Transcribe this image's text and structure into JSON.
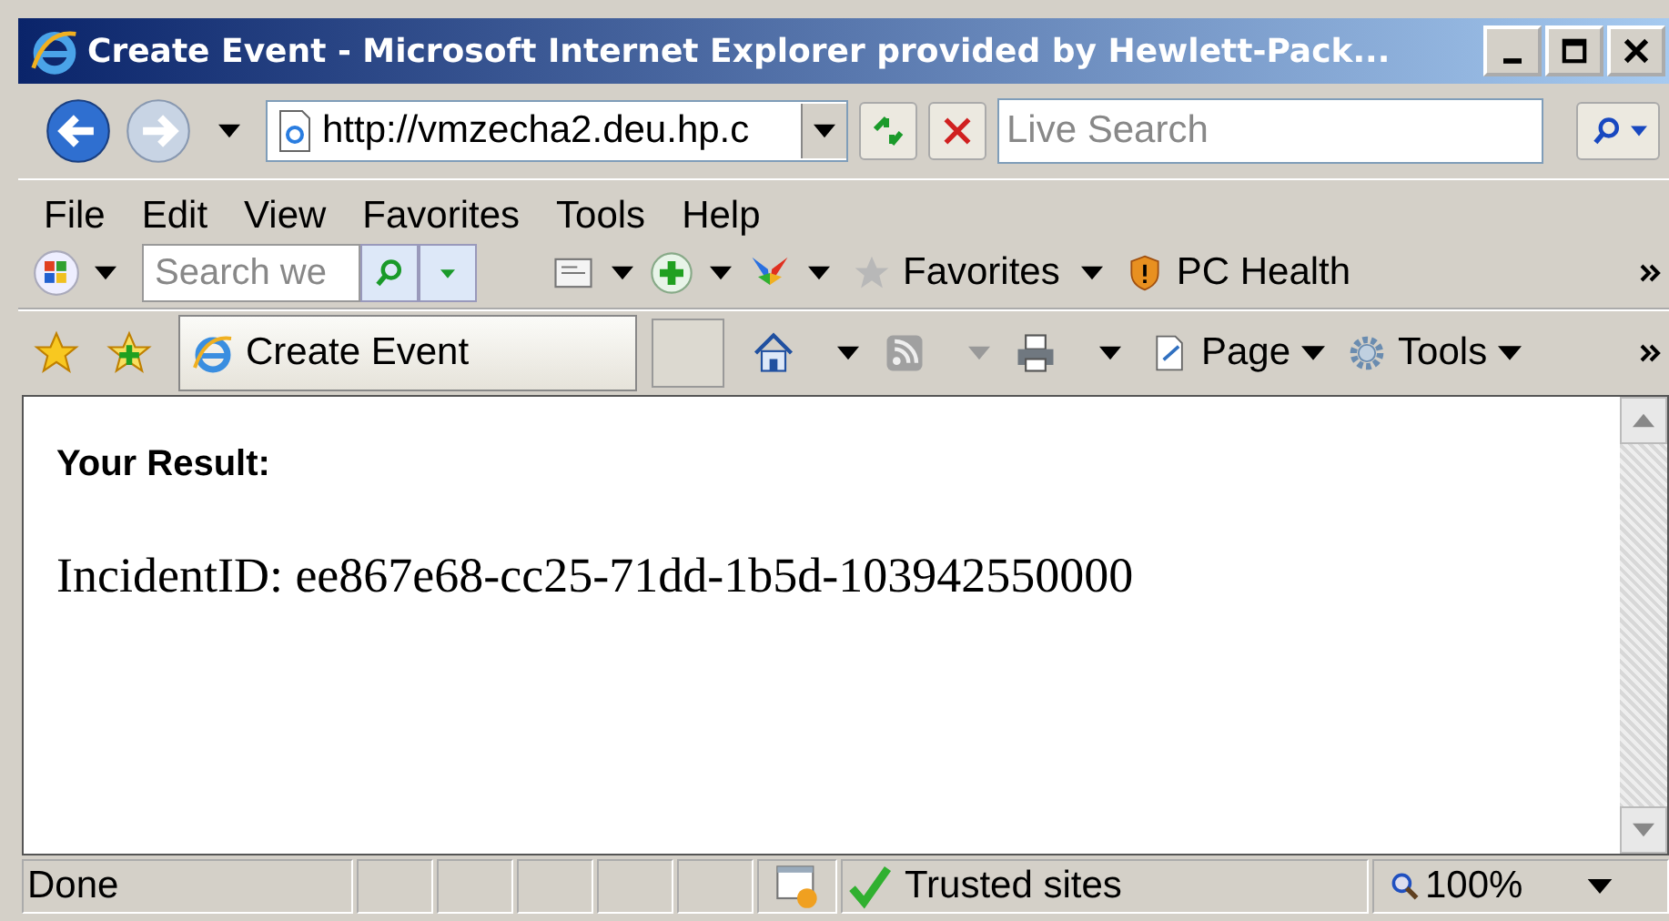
{
  "window": {
    "title": "Create Event - Microsoft Internet Explorer provided by Hewlett-Pack..."
  },
  "address_bar": {
    "value": "http://vmzecha2.deu.hp.c"
  },
  "search": {
    "placeholder": "Live Search"
  },
  "menu": [
    "File",
    "Edit",
    "View",
    "Favorites",
    "Tools",
    "Help"
  ],
  "links_toolbar": {
    "search": {
      "placeholder": "Search we"
    },
    "favorites": "Favorites",
    "pc_health": "PC Health"
  },
  "tabs": [
    {
      "label": "Create Event",
      "selected": true
    }
  ],
  "command_bar": {
    "page": "Page",
    "tools": "Tools"
  },
  "content": {
    "heading": "Your Result:",
    "result": "IncidentID: ee867e68-cc25-71dd-1b5d-103942550000"
  },
  "status_bar": {
    "status": "Done",
    "zone": "Trusted sites",
    "zoom": "100%"
  }
}
